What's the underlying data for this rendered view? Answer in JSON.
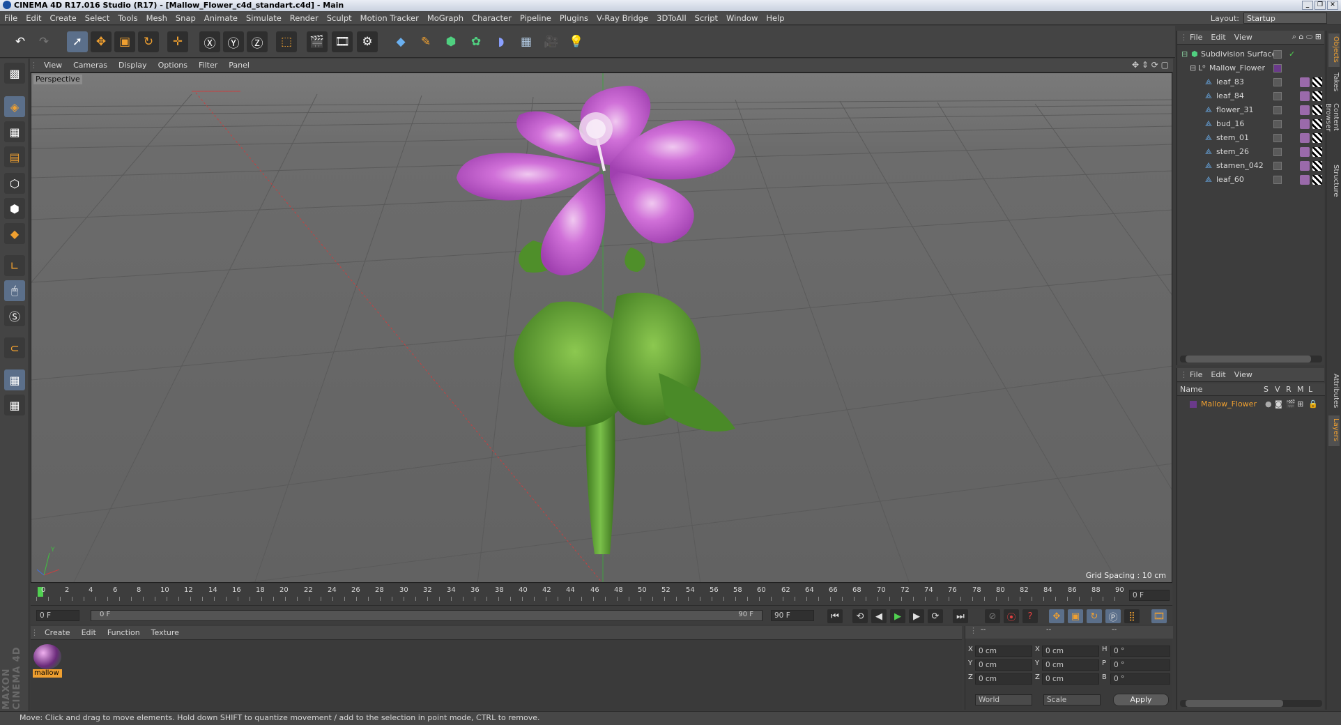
{
  "app": {
    "title": "CINEMA 4D R17.016 Studio (R17) - [Mallow_Flower_c4d_standart.c4d] - Main"
  },
  "menu": [
    "File",
    "Edit",
    "Create",
    "Select",
    "Tools",
    "Mesh",
    "Snap",
    "Animate",
    "Simulate",
    "Render",
    "Sculpt",
    "Motion Tracker",
    "MoGraph",
    "Character",
    "Pipeline",
    "Plugins",
    "V-Ray Bridge",
    "3DToAll",
    "Script",
    "Window",
    "Help"
  ],
  "layout": {
    "label": "Layout:",
    "value": "Startup"
  },
  "viewport": {
    "menu": [
      "View",
      "Cameras",
      "Display",
      "Options",
      "Filter",
      "Panel"
    ],
    "label": "Perspective",
    "grid_spacing": "Grid Spacing : 10 cm"
  },
  "timeline": {
    "ticks": [
      "0",
      "2",
      "4",
      "6",
      "8",
      "10",
      "12",
      "14",
      "16",
      "18",
      "20",
      "22",
      "24",
      "26",
      "28",
      "30",
      "32",
      "34",
      "36",
      "38",
      "40",
      "42",
      "44",
      "46",
      "48",
      "50",
      "52",
      "54",
      "56",
      "58",
      "60",
      "62",
      "64",
      "66",
      "68",
      "70",
      "72",
      "74",
      "76",
      "78",
      "80",
      "82",
      "84",
      "86",
      "88",
      "90"
    ],
    "current_frame": "0 F",
    "start": "0 F",
    "range_start": "0 F",
    "range_end": "90 F",
    "end": "90 F"
  },
  "material": {
    "menu": [
      "Create",
      "Edit",
      "Function",
      "Texture"
    ],
    "name": "mallow",
    "logo": "MAXON CINEMA 4D"
  },
  "coords": {
    "header": [
      "--",
      "--",
      "--"
    ],
    "rows": [
      {
        "a": "X",
        "av": "0 cm",
        "b": "X",
        "bv": "0 cm",
        "c": "H",
        "cv": "0 °"
      },
      {
        "a": "Y",
        "av": "0 cm",
        "b": "Y",
        "bv": "0 cm",
        "c": "P",
        "cv": "0 °"
      },
      {
        "a": "Z",
        "av": "0 cm",
        "b": "Z",
        "bv": "0 cm",
        "c": "B",
        "cv": "0 °"
      }
    ],
    "mode": "World",
    "scale": "Scale",
    "apply": "Apply"
  },
  "status": "Move: Click and drag to move elements. Hold down SHIFT to quantize movement / add to the selection in point mode, CTRL to remove.",
  "objects": {
    "menu": [
      "File",
      "Edit",
      "View"
    ],
    "items": [
      {
        "name": "Subdivision Surface",
        "indent": 0
      },
      {
        "name": "Mallow_Flower",
        "indent": 1
      },
      {
        "name": "leaf_83",
        "indent": 2
      },
      {
        "name": "leaf_84",
        "indent": 2
      },
      {
        "name": "flower_31",
        "indent": 2
      },
      {
        "name": "bud_16",
        "indent": 2
      },
      {
        "name": "stem_01",
        "indent": 2
      },
      {
        "name": "stem_26",
        "indent": 2
      },
      {
        "name": "stamen_042",
        "indent": 2
      },
      {
        "name": "leaf_60",
        "indent": 2
      }
    ]
  },
  "layers": {
    "menu": [
      "File",
      "Edit",
      "View"
    ],
    "header": {
      "name": "Name",
      "cols": [
        "S",
        "V",
        "R",
        "M",
        "L"
      ]
    },
    "items": [
      {
        "name": "Mallow_Flower"
      }
    ]
  },
  "sidetabs": [
    "Objects",
    "Takes",
    "Content Browser",
    "Structure",
    "Attributes",
    "Layers"
  ],
  "colors": {
    "accent": "#f0a030",
    "viewport_bg": "#6d6d6d",
    "petal": "#c860c8",
    "leaf": "#5a9a2a"
  }
}
